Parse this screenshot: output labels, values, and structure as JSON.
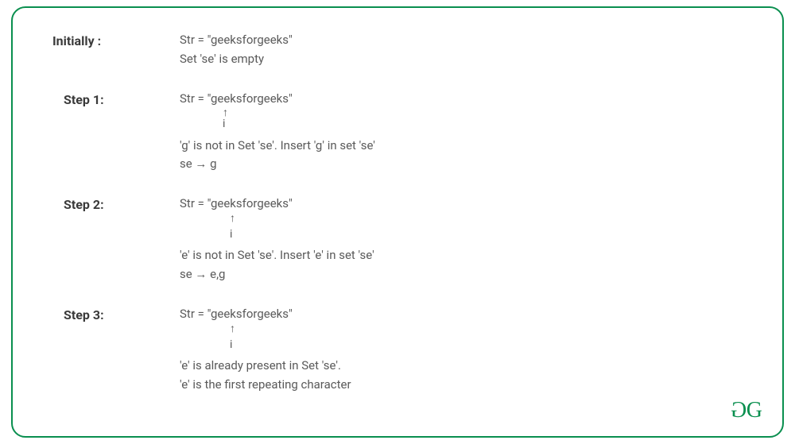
{
  "colors": {
    "accent": "#0a8f4f",
    "text_label": "#3a3a3a",
    "text_body": "#5a5a5a"
  },
  "initially": {
    "label": "Initially :",
    "line1": "Str = \"geeksforgeeks\"",
    "line2": "Set 'se' is empty"
  },
  "steps": [
    {
      "label": "Step 1:",
      "str_line": "Str = \"geeksforgeeks\"",
      "pointer_arrow": "↑",
      "pointer_i": "i",
      "desc": "'g' is not in Set 'se'. Insert 'g' in set 'se'",
      "se_line": "se → g"
    },
    {
      "label": "Step 2:",
      "str_line": "Str = \"geeksforgeeks\"",
      "pointer_arrow": "↑",
      "pointer_i": "i",
      "desc": "'e' is not in Set 'se'. Insert 'e' in set 'se'",
      "se_line": "se → e,g"
    },
    {
      "label": "Step 3:",
      "str_line": "Str = \"geeksforgeeks\"",
      "pointer_arrow": "↑",
      "pointer_i": "i",
      "desc1": "'e' is already present in Set 'se'.",
      "desc2": "'e' is the first repeating character"
    }
  ],
  "logo": {
    "g1": "G",
    "g2": "G"
  }
}
